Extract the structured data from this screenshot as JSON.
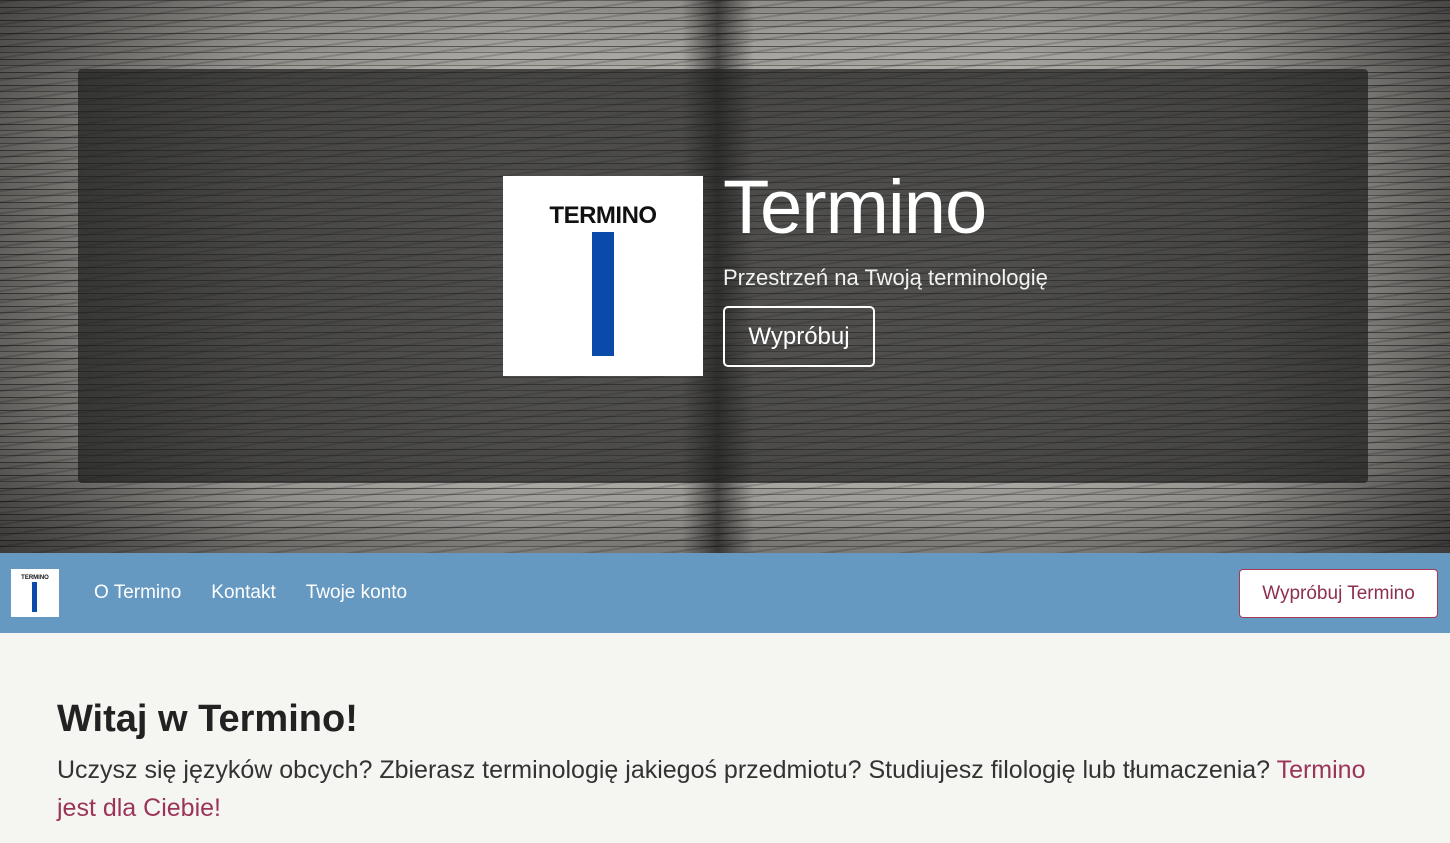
{
  "hero": {
    "logo_text": "TERMINO",
    "title": "Termino",
    "subtitle": "Przestrzeń na Twoją terminologię",
    "button_label": "Wypróbuj"
  },
  "navbar": {
    "logo_text": "TERMINO",
    "links": [
      {
        "label": "O Termino"
      },
      {
        "label": "Kontakt"
      },
      {
        "label": "Twoje konto"
      }
    ],
    "cta_label": "Wypróbuj Termino",
    "background_color": "#6699c2"
  },
  "main": {
    "heading": "Witaj w Termino!",
    "intro_text": "Uczysz się języków obcych? Zbierasz terminologię jakiegoś przedmiotu? Studiujesz filologię lub tłumaczenia? ",
    "intro_link": "Termino jest dla Ciebie!"
  },
  "colors": {
    "accent": "#9b3459",
    "logo_bar": "#0a4aa8"
  }
}
